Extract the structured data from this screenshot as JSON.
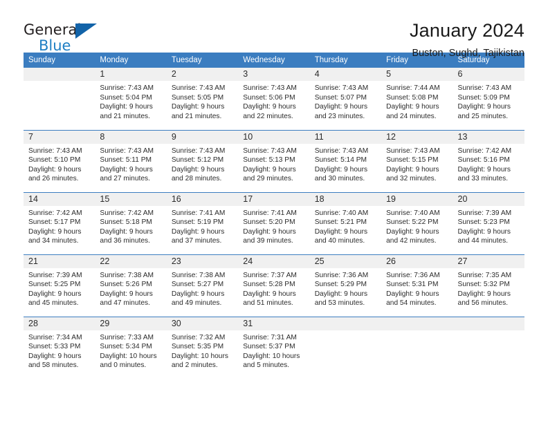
{
  "brand": {
    "name_part1": "General",
    "name_part2": "Blue",
    "logo_icon": "triangle-flag-icon"
  },
  "header": {
    "month_title": "January 2024",
    "location": "Buston, Sughd, Tajikistan"
  },
  "colors": {
    "header_blue": "#3b7dc0",
    "brand_blue": "#1f7fc4",
    "daynum_band": "#f0f0f0",
    "text": "#2b2b2b"
  },
  "weekday_headers": [
    "Sunday",
    "Monday",
    "Tuesday",
    "Wednesday",
    "Thursday",
    "Friday",
    "Saturday"
  ],
  "weeks": [
    [
      {
        "day": "",
        "sunrise": "",
        "sunset": "",
        "daylight1": "",
        "daylight2": ""
      },
      {
        "day": "1",
        "sunrise": "Sunrise: 7:43 AM",
        "sunset": "Sunset: 5:04 PM",
        "daylight1": "Daylight: 9 hours",
        "daylight2": "and 21 minutes."
      },
      {
        "day": "2",
        "sunrise": "Sunrise: 7:43 AM",
        "sunset": "Sunset: 5:05 PM",
        "daylight1": "Daylight: 9 hours",
        "daylight2": "and 21 minutes."
      },
      {
        "day": "3",
        "sunrise": "Sunrise: 7:43 AM",
        "sunset": "Sunset: 5:06 PM",
        "daylight1": "Daylight: 9 hours",
        "daylight2": "and 22 minutes."
      },
      {
        "day": "4",
        "sunrise": "Sunrise: 7:43 AM",
        "sunset": "Sunset: 5:07 PM",
        "daylight1": "Daylight: 9 hours",
        "daylight2": "and 23 minutes."
      },
      {
        "day": "5",
        "sunrise": "Sunrise: 7:44 AM",
        "sunset": "Sunset: 5:08 PM",
        "daylight1": "Daylight: 9 hours",
        "daylight2": "and 24 minutes."
      },
      {
        "day": "6",
        "sunrise": "Sunrise: 7:43 AM",
        "sunset": "Sunset: 5:09 PM",
        "daylight1": "Daylight: 9 hours",
        "daylight2": "and 25 minutes."
      }
    ],
    [
      {
        "day": "7",
        "sunrise": "Sunrise: 7:43 AM",
        "sunset": "Sunset: 5:10 PM",
        "daylight1": "Daylight: 9 hours",
        "daylight2": "and 26 minutes."
      },
      {
        "day": "8",
        "sunrise": "Sunrise: 7:43 AM",
        "sunset": "Sunset: 5:11 PM",
        "daylight1": "Daylight: 9 hours",
        "daylight2": "and 27 minutes."
      },
      {
        "day": "9",
        "sunrise": "Sunrise: 7:43 AM",
        "sunset": "Sunset: 5:12 PM",
        "daylight1": "Daylight: 9 hours",
        "daylight2": "and 28 minutes."
      },
      {
        "day": "10",
        "sunrise": "Sunrise: 7:43 AM",
        "sunset": "Sunset: 5:13 PM",
        "daylight1": "Daylight: 9 hours",
        "daylight2": "and 29 minutes."
      },
      {
        "day": "11",
        "sunrise": "Sunrise: 7:43 AM",
        "sunset": "Sunset: 5:14 PM",
        "daylight1": "Daylight: 9 hours",
        "daylight2": "and 30 minutes."
      },
      {
        "day": "12",
        "sunrise": "Sunrise: 7:43 AM",
        "sunset": "Sunset: 5:15 PM",
        "daylight1": "Daylight: 9 hours",
        "daylight2": "and 32 minutes."
      },
      {
        "day": "13",
        "sunrise": "Sunrise: 7:42 AM",
        "sunset": "Sunset: 5:16 PM",
        "daylight1": "Daylight: 9 hours",
        "daylight2": "and 33 minutes."
      }
    ],
    [
      {
        "day": "14",
        "sunrise": "Sunrise: 7:42 AM",
        "sunset": "Sunset: 5:17 PM",
        "daylight1": "Daylight: 9 hours",
        "daylight2": "and 34 minutes."
      },
      {
        "day": "15",
        "sunrise": "Sunrise: 7:42 AM",
        "sunset": "Sunset: 5:18 PM",
        "daylight1": "Daylight: 9 hours",
        "daylight2": "and 36 minutes."
      },
      {
        "day": "16",
        "sunrise": "Sunrise: 7:41 AM",
        "sunset": "Sunset: 5:19 PM",
        "daylight1": "Daylight: 9 hours",
        "daylight2": "and 37 minutes."
      },
      {
        "day": "17",
        "sunrise": "Sunrise: 7:41 AM",
        "sunset": "Sunset: 5:20 PM",
        "daylight1": "Daylight: 9 hours",
        "daylight2": "and 39 minutes."
      },
      {
        "day": "18",
        "sunrise": "Sunrise: 7:40 AM",
        "sunset": "Sunset: 5:21 PM",
        "daylight1": "Daylight: 9 hours",
        "daylight2": "and 40 minutes."
      },
      {
        "day": "19",
        "sunrise": "Sunrise: 7:40 AM",
        "sunset": "Sunset: 5:22 PM",
        "daylight1": "Daylight: 9 hours",
        "daylight2": "and 42 minutes."
      },
      {
        "day": "20",
        "sunrise": "Sunrise: 7:39 AM",
        "sunset": "Sunset: 5:23 PM",
        "daylight1": "Daylight: 9 hours",
        "daylight2": "and 44 minutes."
      }
    ],
    [
      {
        "day": "21",
        "sunrise": "Sunrise: 7:39 AM",
        "sunset": "Sunset: 5:25 PM",
        "daylight1": "Daylight: 9 hours",
        "daylight2": "and 45 minutes."
      },
      {
        "day": "22",
        "sunrise": "Sunrise: 7:38 AM",
        "sunset": "Sunset: 5:26 PM",
        "daylight1": "Daylight: 9 hours",
        "daylight2": "and 47 minutes."
      },
      {
        "day": "23",
        "sunrise": "Sunrise: 7:38 AM",
        "sunset": "Sunset: 5:27 PM",
        "daylight1": "Daylight: 9 hours",
        "daylight2": "and 49 minutes."
      },
      {
        "day": "24",
        "sunrise": "Sunrise: 7:37 AM",
        "sunset": "Sunset: 5:28 PM",
        "daylight1": "Daylight: 9 hours",
        "daylight2": "and 51 minutes."
      },
      {
        "day": "25",
        "sunrise": "Sunrise: 7:36 AM",
        "sunset": "Sunset: 5:29 PM",
        "daylight1": "Daylight: 9 hours",
        "daylight2": "and 53 minutes."
      },
      {
        "day": "26",
        "sunrise": "Sunrise: 7:36 AM",
        "sunset": "Sunset: 5:31 PM",
        "daylight1": "Daylight: 9 hours",
        "daylight2": "and 54 minutes."
      },
      {
        "day": "27",
        "sunrise": "Sunrise: 7:35 AM",
        "sunset": "Sunset: 5:32 PM",
        "daylight1": "Daylight: 9 hours",
        "daylight2": "and 56 minutes."
      }
    ],
    [
      {
        "day": "28",
        "sunrise": "Sunrise: 7:34 AM",
        "sunset": "Sunset: 5:33 PM",
        "daylight1": "Daylight: 9 hours",
        "daylight2": "and 58 minutes."
      },
      {
        "day": "29",
        "sunrise": "Sunrise: 7:33 AM",
        "sunset": "Sunset: 5:34 PM",
        "daylight1": "Daylight: 10 hours",
        "daylight2": "and 0 minutes."
      },
      {
        "day": "30",
        "sunrise": "Sunrise: 7:32 AM",
        "sunset": "Sunset: 5:35 PM",
        "daylight1": "Daylight: 10 hours",
        "daylight2": "and 2 minutes."
      },
      {
        "day": "31",
        "sunrise": "Sunrise: 7:31 AM",
        "sunset": "Sunset: 5:37 PM",
        "daylight1": "Daylight: 10 hours",
        "daylight2": "and 5 minutes."
      },
      {
        "day": "",
        "sunrise": "",
        "sunset": "",
        "daylight1": "",
        "daylight2": ""
      },
      {
        "day": "",
        "sunrise": "",
        "sunset": "",
        "daylight1": "",
        "daylight2": ""
      },
      {
        "day": "",
        "sunrise": "",
        "sunset": "",
        "daylight1": "",
        "daylight2": ""
      }
    ]
  ]
}
